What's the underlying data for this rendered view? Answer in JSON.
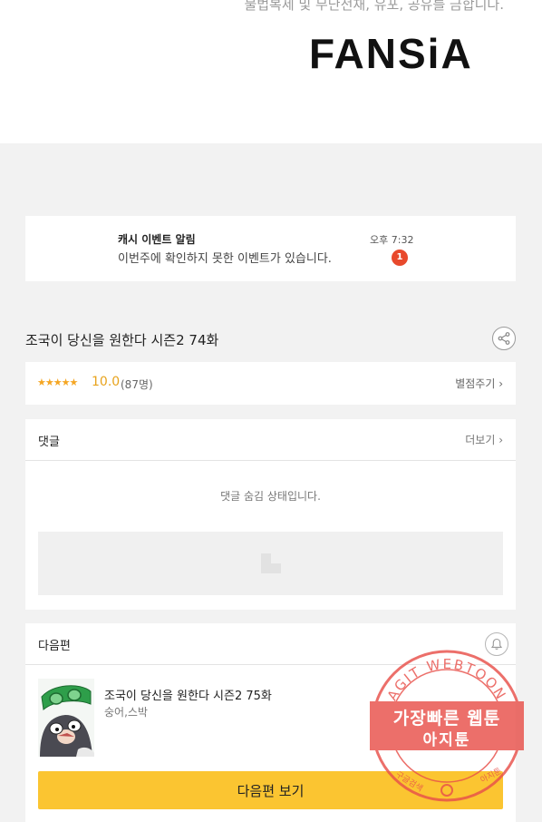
{
  "header": {
    "notice": "불법복제 및 무단전재, 유포, 공유를 금합니다.",
    "logo": "FANSiA"
  },
  "alert": {
    "title": "캐시 이벤트 알림",
    "time": "오후 7:32",
    "message": "이번주에 확인하지 못한 이벤트가 있습니다.",
    "badge": "1"
  },
  "episode": {
    "title": "조국이 당신을 원한다 시즌2 74화",
    "share_icon": "share-icon"
  },
  "rating": {
    "stars": "★★★★★",
    "score": "10.0",
    "count": "(87명)",
    "rate_label": "별점주기 ›"
  },
  "comments": {
    "title": "댓글",
    "more_label": "더보기 ›",
    "hidden_text": "댓글 숨김 상태입니다."
  },
  "next": {
    "title": "다음편",
    "bell_icon": "bell-icon",
    "episode_title": "조국이 당신을 원한다 시즌2 75화",
    "authors": "숭어,스박",
    "button_label": "다음편 보기"
  },
  "watermark": {
    "ring_text": "AGIT WEBTOON",
    "line1": "가장빠른 웹툰",
    "line2": "아지툰",
    "bottom_text": "구글검색 G 아지툰",
    "color": "#e8504a"
  }
}
